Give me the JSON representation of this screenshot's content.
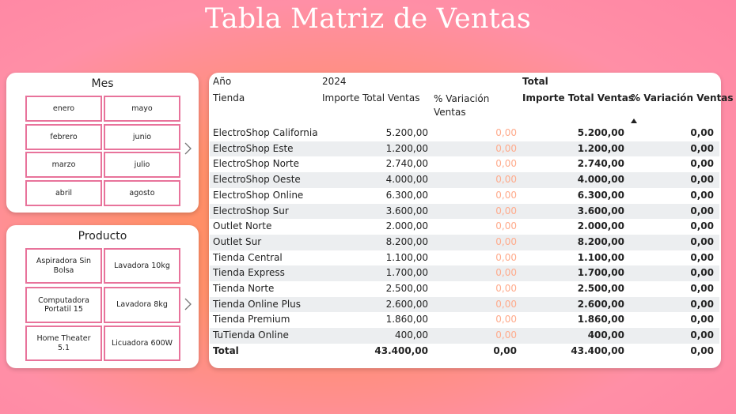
{
  "page": {
    "title": "Tabla Matriz de Ventas"
  },
  "slicers": {
    "mes": {
      "title": "Mes",
      "items": [
        "enero",
        "mayo",
        "febrero",
        "junio",
        "marzo",
        "julio",
        "abril",
        "agosto"
      ]
    },
    "producto": {
      "title": "Producto",
      "items": [
        "Aspiradora Sin Bolsa",
        "Lavadora 10kg",
        "Computadora Portatil 15",
        "Lavadora 8kg",
        "Home Theater 5.1",
        "Licuadora 600W"
      ]
    }
  },
  "matrix": {
    "year_label": "Año",
    "year_value": "2024",
    "total_label": "Total",
    "store_header": "Tienda",
    "col_importe": "Importe Total Ventas",
    "col_variacion_line1": "% Variación",
    "col_variacion_line2": "Ventas",
    "col_total_importe": "Importe Total Ventas",
    "col_total_variacion": "% Variación Ventas",
    "rows": [
      {
        "store": "ElectroShop California",
        "importe": "5.200,00",
        "variacion": "0,00",
        "total_importe": "5.200,00",
        "total_variacion": "0,00"
      },
      {
        "store": "ElectroShop Este",
        "importe": "1.200,00",
        "variacion": "0,00",
        "total_importe": "1.200,00",
        "total_variacion": "0,00"
      },
      {
        "store": "ElectroShop Norte",
        "importe": "2.740,00",
        "variacion": "0,00",
        "total_importe": "2.740,00",
        "total_variacion": "0,00"
      },
      {
        "store": "ElectroShop Oeste",
        "importe": "4.000,00",
        "variacion": "0,00",
        "total_importe": "4.000,00",
        "total_variacion": "0,00"
      },
      {
        "store": "ElectroShop Online",
        "importe": "6.300,00",
        "variacion": "0,00",
        "total_importe": "6.300,00",
        "total_variacion": "0,00"
      },
      {
        "store": "ElectroShop Sur",
        "importe": "3.600,00",
        "variacion": "0,00",
        "total_importe": "3.600,00",
        "total_variacion": "0,00"
      },
      {
        "store": "Outlet Norte",
        "importe": "2.000,00",
        "variacion": "0,00",
        "total_importe": "2.000,00",
        "total_variacion": "0,00"
      },
      {
        "store": "Outlet Sur",
        "importe": "8.200,00",
        "variacion": "0,00",
        "total_importe": "8.200,00",
        "total_variacion": "0,00"
      },
      {
        "store": "Tienda Central",
        "importe": "1.100,00",
        "variacion": "0,00",
        "total_importe": "1.100,00",
        "total_variacion": "0,00"
      },
      {
        "store": "Tienda Express",
        "importe": "1.700,00",
        "variacion": "0,00",
        "total_importe": "1.700,00",
        "total_variacion": "0,00"
      },
      {
        "store": "Tienda Norte",
        "importe": "2.500,00",
        "variacion": "0,00",
        "total_importe": "2.500,00",
        "total_variacion": "0,00"
      },
      {
        "store": "Tienda Online Plus",
        "importe": "2.600,00",
        "variacion": "0,00",
        "total_importe": "2.600,00",
        "total_variacion": "0,00"
      },
      {
        "store": "Tienda Premium",
        "importe": "1.860,00",
        "variacion": "0,00",
        "total_importe": "1.860,00",
        "total_variacion": "0,00"
      },
      {
        "store": "TuTienda Online",
        "importe": "400,00",
        "variacion": "0,00",
        "total_importe": "400,00",
        "total_variacion": "0,00"
      }
    ],
    "total_row": {
      "store": "Total",
      "importe": "43.400,00",
      "variacion": "0,00",
      "total_importe": "43.400,00",
      "total_variacion": "0,00"
    }
  },
  "colors": {
    "accent_border": "#e8739b",
    "variation_text": "#ffab8c",
    "row_stripe": "#eceef0"
  },
  "icons": {
    "slicer_next": "chevron-right-icon",
    "sort": "sort-ascending-icon"
  }
}
